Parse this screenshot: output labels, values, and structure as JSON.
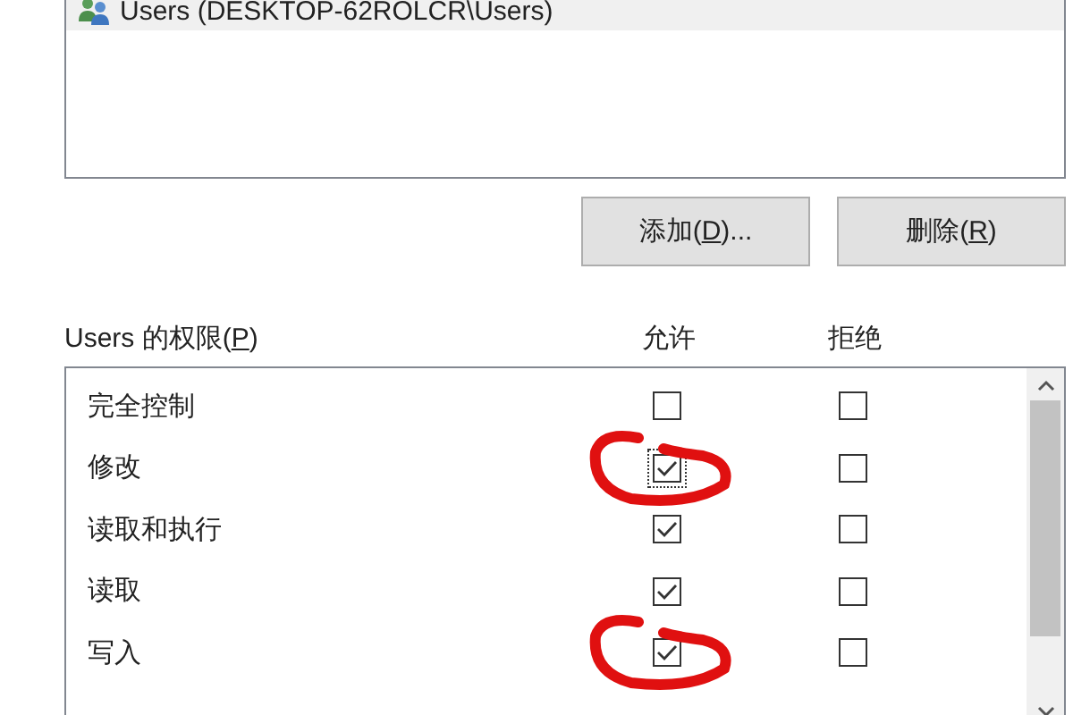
{
  "principals": [
    {
      "name": "Users (DESKTOP-62ROLCR\\Users)",
      "selected": true
    }
  ],
  "buttons": [
    {
      "before": "添加(",
      "key": "D",
      "after": ")..."
    },
    {
      "before": "删除(",
      "key": "R",
      "after": ")"
    }
  ],
  "permissions": {
    "title_before": "Users 的权限(",
    "title_key": "P",
    "title_after": ")",
    "allow_header": "允许",
    "deny_header": "拒绝",
    "rows": [
      {
        "name": "完全控制",
        "allow": false,
        "deny": false,
        "focused": false,
        "circled": false
      },
      {
        "name": "修改",
        "allow": true,
        "deny": false,
        "focused": true,
        "circled": true
      },
      {
        "name": "读取和执行",
        "allow": true,
        "deny": false,
        "focused": false,
        "circled": false
      },
      {
        "name": "读取",
        "allow": true,
        "deny": false,
        "focused": false,
        "circled": false
      },
      {
        "name": "写入",
        "allow": true,
        "deny": false,
        "focused": false,
        "circled": true
      }
    ]
  }
}
